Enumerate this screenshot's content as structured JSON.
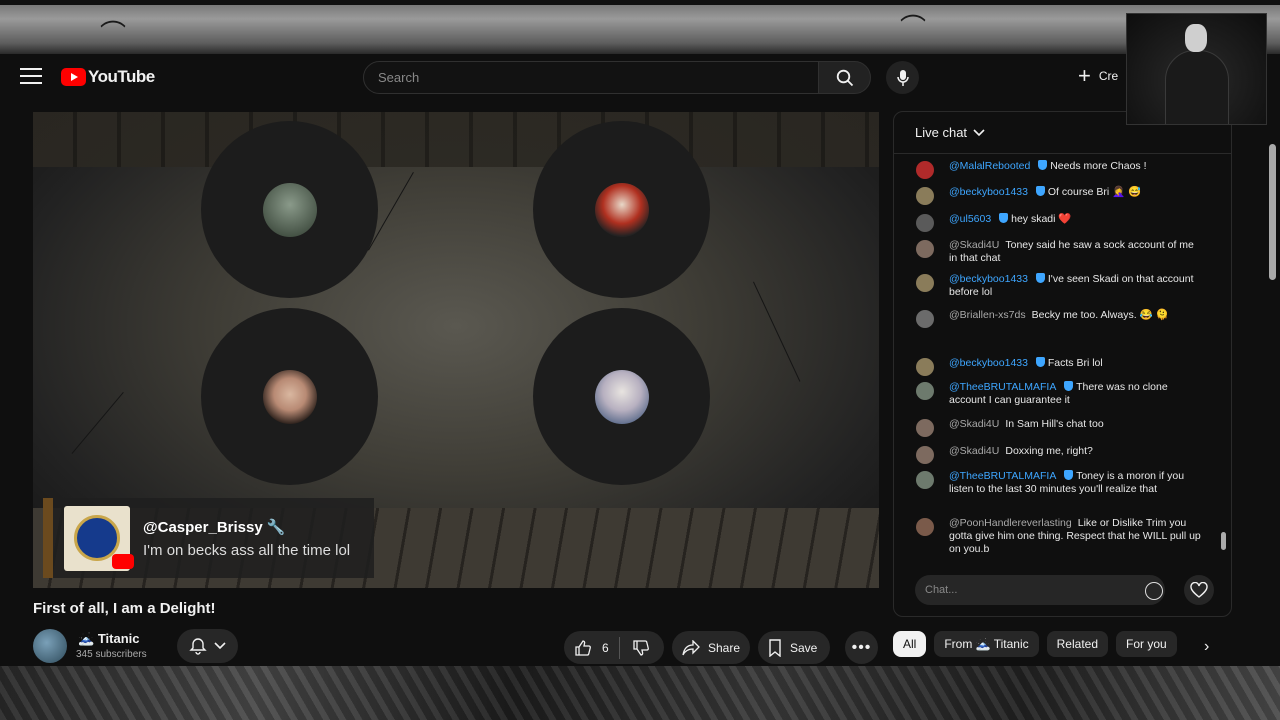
{
  "header": {
    "logo_text": "YouTube",
    "search_placeholder": "Search",
    "create_label": "Cre"
  },
  "video": {
    "title": "First of all, I am a Delight!",
    "overlay_comment": {
      "author": "@Casper_Brissy 🔧",
      "message": "I'm on becks ass all the time lol"
    }
  },
  "channel": {
    "name": "Titanic",
    "subscribers": "345 subscribers"
  },
  "actions": {
    "like_count": "6",
    "share_label": "Share",
    "save_label": "Save"
  },
  "chat": {
    "header": "Live chat",
    "input_placeholder": "Chat...",
    "messages": [
      {
        "author": "@MalalRebooted",
        "member": true,
        "text": "Needs more Chaos !",
        "avatar_color": "#b02a2a"
      },
      {
        "author": "@beckyboo1433",
        "member": true,
        "text": "Of course Bri 🤦‍♀️ 😅",
        "avatar_color": "#8a7c5a"
      },
      {
        "author": "@ul5603",
        "member": true,
        "text": "hey skadi ❤️",
        "avatar_color": "#5a5a5a"
      },
      {
        "author": "@Skadi4U",
        "member": false,
        "text": "Toney said he saw a sock account of me in that chat",
        "avatar_color": "#7d6a5f"
      },
      {
        "author": "@beckyboo1433",
        "member": true,
        "text": "I've seen Skadi on that account before lol",
        "avatar_color": "#8a7c5a"
      },
      {
        "author": "@Briallen-xs7ds",
        "member": false,
        "text": "Becky me too. Always. 😂 🫠",
        "avatar_color": "#6b6b6b"
      },
      {
        "author": "@beckyboo1433",
        "member": true,
        "text": "Facts Bri lol",
        "avatar_color": "#8a7c5a"
      },
      {
        "author": "@TheeBRUTALMAFIA",
        "member": true,
        "text": "There was no clone account I can guarantee it",
        "avatar_color": "#6d7a6d"
      },
      {
        "author": "@Skadi4U",
        "member": false,
        "text": "In Sam Hill's chat too",
        "avatar_color": "#7d6a5f"
      },
      {
        "author": "@Skadi4U",
        "member": false,
        "text": "Doxxing me, right?",
        "avatar_color": "#7d6a5f"
      },
      {
        "author": "@TheeBRUTALMAFIA",
        "member": true,
        "text": "Toney is a moron if you listen to the last 30 minutes you'll realize that",
        "avatar_color": "#6d7a6d"
      },
      {
        "author": "@PoonHandlereverlasting",
        "member": false,
        "text": "Like or Dislike Trim you gotta give him one thing. Respect that he WILL pull up on you.b",
        "avatar_color": "#7a5a4a"
      }
    ]
  },
  "chips": [
    "All",
    "From 🗻 Titanic",
    "Related",
    "For you"
  ],
  "colors": {
    "accent_blue": "#3ea6ff",
    "brand_red": "#ff0000",
    "background": "#0f0f0f"
  }
}
